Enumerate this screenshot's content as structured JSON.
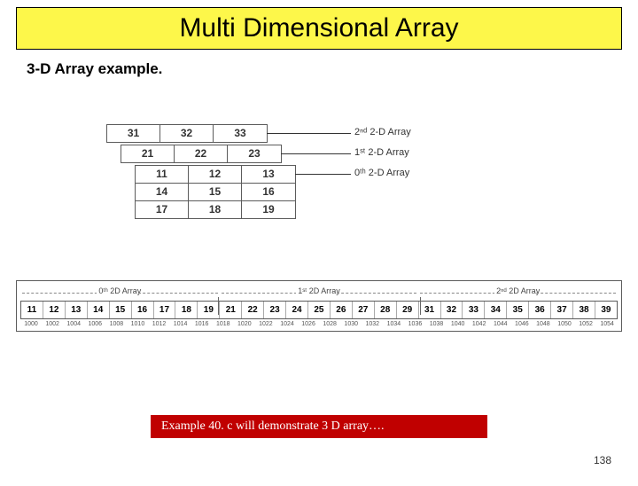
{
  "title": "Multi Dimensional Array",
  "subtitle": "3-D Array example.",
  "stack": {
    "layer2": [
      "31",
      "32",
      "33"
    ],
    "layer1": [
      "21",
      "22",
      "23"
    ],
    "layer0": [
      [
        "11",
        "12",
        "13"
      ],
      [
        "14",
        "15",
        "16"
      ],
      [
        "17",
        "18",
        "19"
      ]
    ],
    "labels": {
      "l2": "2ⁿᵈ 2-D Array",
      "l1": "1ˢᵗ 2-D Array",
      "l0": "0ᵗʰ 2-D Array"
    }
  },
  "mem": {
    "ranges": {
      "r0": "0ᵗʰ 2D Array",
      "r1": "1ˢᵗ 2D Array",
      "r2": "2ⁿᵈ 2D Array"
    },
    "values": [
      "11",
      "12",
      "13",
      "14",
      "15",
      "16",
      "17",
      "18",
      "19",
      "21",
      "22",
      "23",
      "24",
      "25",
      "26",
      "27",
      "28",
      "29",
      "31",
      "32",
      "33",
      "34",
      "35",
      "36",
      "37",
      "38",
      "39"
    ],
    "addrs": [
      "1000",
      "1002",
      "1004",
      "1006",
      "1008",
      "1010",
      "1012",
      "1014",
      "1016",
      "1018",
      "1020",
      "1022",
      "1024",
      "1026",
      "1028",
      "1030",
      "1032",
      "1034",
      "1036",
      "1038",
      "1040",
      "1042",
      "1044",
      "1046",
      "1048",
      "1050",
      "1052",
      "1054"
    ]
  },
  "footer": {
    "text": "Example 40. c will demonstrate 3 D array…."
  },
  "page": "138",
  "chart_data": {
    "type": "table",
    "title": "3-D Array (3×3×3) stacked view and linear memory layout",
    "array3d": [
      [
        [
          "11",
          "12",
          "13"
        ],
        [
          "14",
          "15",
          "16"
        ],
        [
          "17",
          "18",
          "19"
        ]
      ],
      [
        [
          "21",
          "22",
          "23"
        ],
        [
          "24",
          "25",
          "26"
        ],
        [
          "27",
          "28",
          "29"
        ]
      ],
      [
        [
          "31",
          "32",
          "33"
        ],
        [
          "34",
          "35",
          "36"
        ],
        [
          "37",
          "38",
          "39"
        ]
      ]
    ],
    "memory_layout": {
      "values": [
        "11",
        "12",
        "13",
        "14",
        "15",
        "16",
        "17",
        "18",
        "19",
        "21",
        "22",
        "23",
        "24",
        "25",
        "26",
        "27",
        "28",
        "29",
        "31",
        "32",
        "33",
        "34",
        "35",
        "36",
        "37",
        "38",
        "39"
      ],
      "addresses_start": 1000,
      "address_stride": 2
    }
  }
}
